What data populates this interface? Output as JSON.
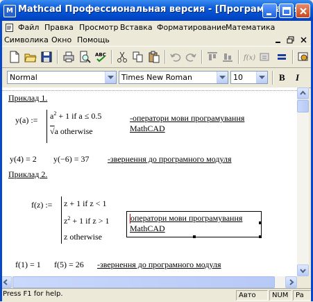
{
  "window": {
    "title": "Mathcad Профессиональная версия - [Програмування]"
  },
  "menu1": [
    "Файл",
    "Правка",
    "Просмотр",
    "Вставка",
    "Форматирование",
    "Математика"
  ],
  "menu2": [
    "Символика",
    "Окно",
    "Помощь"
  ],
  "format": {
    "style": "Normal",
    "font": "Times New Roman",
    "size": "10",
    "bold": "B",
    "italic": "I"
  },
  "doc": {
    "ex1_title": "Приклад 1.",
    "ex1_fname": "y(a) :=",
    "ex1_case1_a": "a",
    "ex1_case1_exp": "2",
    "ex1_case1_b": "+ 1   if   a ≤ 0.5",
    "ex1_case2_root": "√",
    "ex1_case2": "a   otherwise",
    "ex1_comment1": "-оператори мови програмування",
    "ex1_comment2": "MathCAD",
    "ex1_eval1": "y(4) = 2",
    "ex1_eval2": "y(−6) = 37",
    "ex1_eval_comment": "-звернення до програмного модуля",
    "ex2_title": "Приклад 2.",
    "ex2_fname": "f(z) :=",
    "ex2_case1": "z + 1   if   z < 1",
    "ex2_case2_a": "z",
    "ex2_case2_exp": "2",
    "ex2_case2_b": "+ 1   if   z > 1",
    "ex2_case3": "z   otherwise",
    "ex2_comment1": "оператори мови програмування",
    "ex2_comment2": "MathCAD",
    "ex2_eval1": "f(1) = 1",
    "ex2_eval2": "f(5) = 26",
    "ex2_eval_comment": "-звернення до програмного модуля"
  },
  "status": {
    "help": "Press F1 for help.",
    "mode": "Авто",
    "num": "NUM",
    "page": "Pa"
  }
}
